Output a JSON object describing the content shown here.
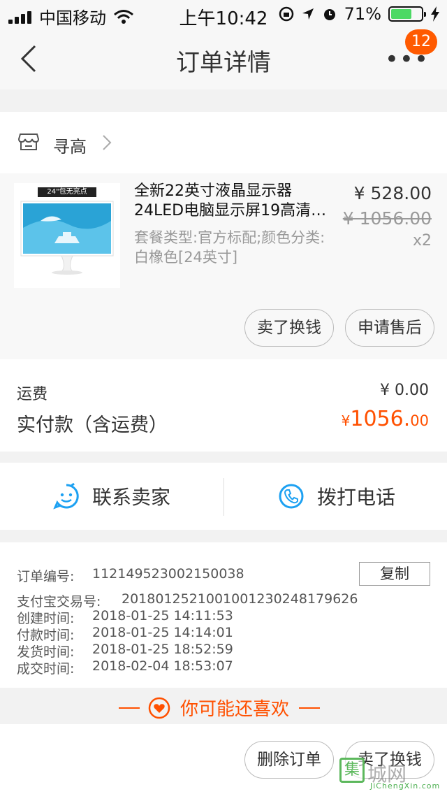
{
  "status_bar": {
    "carrier": "中国移动",
    "time": "上午10:42",
    "battery_percent": "71%",
    "battery_level": 0.71,
    "icons": [
      "signal-icon",
      "wifi-icon",
      "orientation-lock-icon",
      "location-icon",
      "alarm-icon",
      "battery-icon",
      "charging-icon"
    ]
  },
  "nav": {
    "title": "订单详情",
    "badge_count": "12",
    "more_label": "•••"
  },
  "shop": {
    "name": "寻高"
  },
  "product": {
    "thumb_tag": "24\"包无亮点",
    "title": "全新22英寸液晶显示器24LED电脑显示屏19高清…",
    "spec": "套餐类型:官方标配;颜色分类:白橡色[24英寸]",
    "price": "¥ 528.00",
    "original_price": "¥ 1056.00",
    "quantity": "x2",
    "actions": [
      "卖了换钱",
      "申请售后"
    ]
  },
  "fees": {
    "shipping_label": "运费",
    "shipping_value": "¥ 0.00",
    "paid_label": "实付款（含运费）",
    "paid_currency": "¥",
    "paid_integer": "1056.",
    "paid_decimal": "00"
  },
  "contact": {
    "seller_label": "联系卖家",
    "phone_label": "拨打电话"
  },
  "order_info": {
    "copy_label": "复制",
    "rows": [
      {
        "key": "订单编号:",
        "value": "112149523002150038"
      },
      {
        "key": "支付宝交易号:",
        "value": "2018012521001001230248179626"
      },
      {
        "key": "创建时间:",
        "value": "2018-01-25 14:11:53"
      },
      {
        "key": "付款时间:",
        "value": "2018-01-25 14:14:01"
      },
      {
        "key": "发货时间:",
        "value": "2018-01-25 18:52:59"
      },
      {
        "key": "成交时间:",
        "value": "2018-02-04 18:53:07"
      }
    ]
  },
  "recommend": {
    "label": "你可能还喜欢"
  },
  "bottom_bar": {
    "delete_label": "删除订单",
    "sell_label": "卖了换钱"
  },
  "watermark": {
    "box_char": "集",
    "text": "城网",
    "sub": "JiChengXin.com"
  },
  "colors": {
    "accent": "#ff5000",
    "badge": "#ff5a00",
    "contact_icon": "#1da1f2",
    "battery": "#4cd964"
  }
}
